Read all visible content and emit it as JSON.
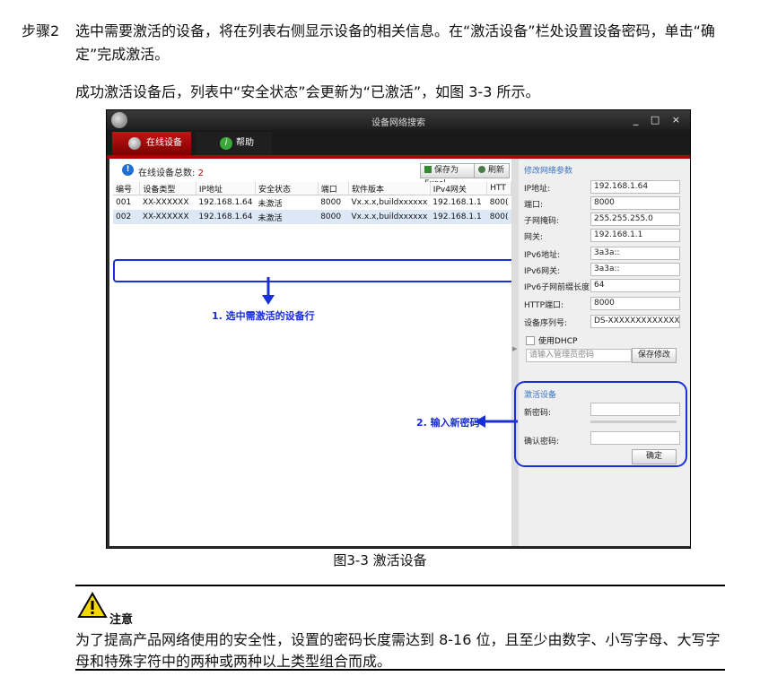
{
  "step": {
    "label": "步骤2",
    "text": "选中需要激活的设备，将在列表右侧显示设备的相关信息。在“激活设备”栏处设置设备密码，单击“确定”完成激活。"
  },
  "result_paragraph": "成功激活设备后，列表中“安全状态”会更新为“已激活”，如图 3-3 所示。",
  "app": {
    "window_title": "设备网络搜索",
    "window_controls": "_ □ ×",
    "tabs": [
      {
        "label": "在线设备"
      },
      {
        "label": "帮助"
      }
    ],
    "help_icon_glyph": "i",
    "online_label": "在线设备总数:",
    "online_count": "2",
    "info_icon_glyph": "!",
    "buttons": {
      "export": "保存为Excel",
      "refresh": "刷新"
    },
    "table": {
      "headers": [
        "编号",
        "设备类型",
        "IP地址",
        "安全状态",
        "端口",
        "软件版本",
        "IPv4网关",
        "HTT"
      ],
      "rows": [
        [
          "001",
          "XX-XXXXXX",
          "192.168.1.64",
          "未激活",
          "8000",
          "Vx.x.x,buildxxxxxx",
          "192.168.1.1",
          "800("
        ],
        [
          "002",
          "XX-XXXXXX",
          "192.168.1.64",
          "未激活",
          "8000",
          "Vx.x.x,buildxxxxxx",
          "192.168.1.1",
          "800("
        ]
      ]
    },
    "callout_select": "1. 选中需激活的设备行",
    "callout_password": "2. 输入新密码",
    "params": {
      "title": "修改网络参数",
      "fields": [
        {
          "label": "IP地址:",
          "value": "192.168.1.64"
        },
        {
          "label": "端口:",
          "value": "8000"
        },
        {
          "label": "子网掩码:",
          "value": "255.255.255.0"
        },
        {
          "label": "网关:",
          "value": "192.168.1.1"
        },
        {
          "label": "IPv6地址:",
          "value": "3a3a::"
        },
        {
          "label": "IPv6网关:",
          "value": "3a3a::"
        },
        {
          "label": "IPv6子网前缀长度:",
          "value": "64"
        },
        {
          "label": "HTTP端口:",
          "value": "8000"
        },
        {
          "label": "设备序列号:",
          "value": "DS-XXXXXXXXXXXXXXXX"
        }
      ],
      "dhcp_label": "使用DHCP",
      "admin_pw_placeholder": "请输入管理员密码",
      "save_label": "保存修改"
    },
    "activate": {
      "title": "激活设备",
      "new_pw_label": "新密码:",
      "confirm_pw_label": "确认密码:",
      "ok_label": "确定"
    }
  },
  "figure_caption": "图3-3  激活设备",
  "note": {
    "title": "注意",
    "text": "为了提高产品网络使用的安全性，设置的密码长度需达到 8-16 位，且至少由数字、小写字母、大写字母和特殊字符中的两种或两种以上类型组合而成。"
  }
}
